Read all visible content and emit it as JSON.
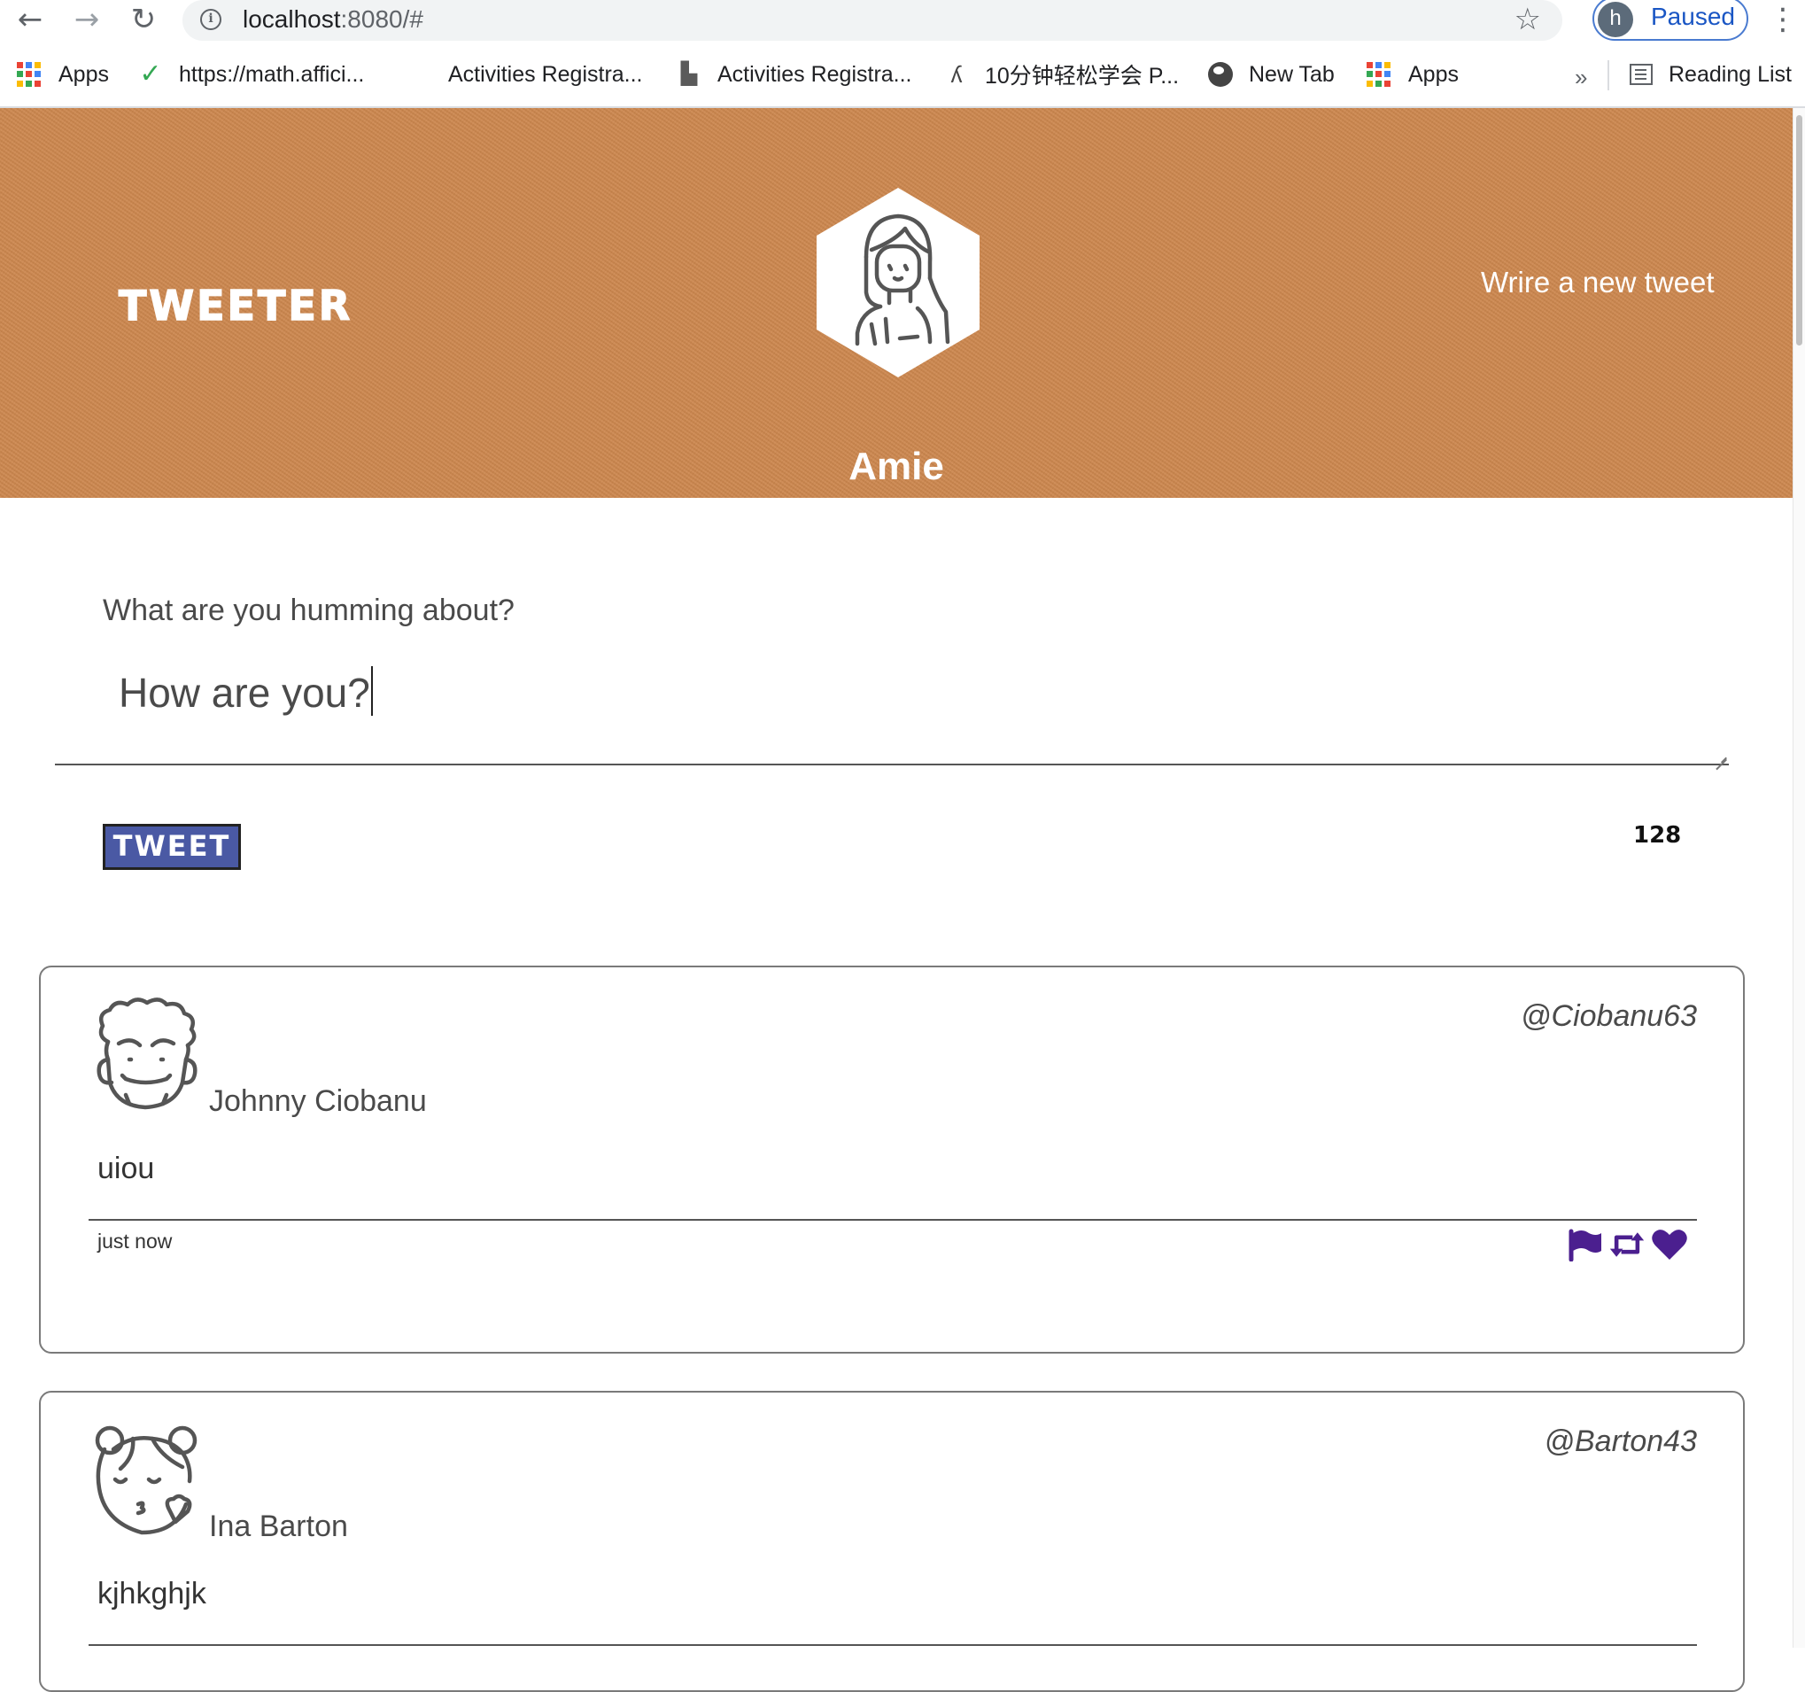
{
  "browser": {
    "url_host": "localhost",
    "url_rest": ":8080/#",
    "profile_initial": "h",
    "profile_status": "Paused",
    "bookmarks": [
      {
        "label": "Apps",
        "icon": "apps-grid-icon"
      },
      {
        "label": "https://math.affici...",
        "icon": "checkmark-icon"
      },
      {
        "label": "Activities Registra...",
        "icon": "none"
      },
      {
        "label": "Activities Registra...",
        "icon": "building-icon"
      },
      {
        "label": "10分钟轻松学会 P...",
        "icon": "glyph-icon"
      },
      {
        "label": "New Tab",
        "icon": "globe-icon"
      },
      {
        "label": "Apps",
        "icon": "apps-grid-icon"
      }
    ],
    "overflow": "»",
    "reading_list": "Reading List"
  },
  "header": {
    "logo": "TWEETER",
    "new_tweet_link": "Wrire a new tweet",
    "username": "Amie",
    "background": "#cd874e"
  },
  "composer": {
    "prompt": "What are you humming about?",
    "value": "How are you?",
    "button_label": "TWEET",
    "char_count": "128",
    "button_color": "#4a59a4"
  },
  "tweets": [
    {
      "author": "Johnny Ciobanu",
      "handle": "@Ciobanu63",
      "content": "uiou",
      "time": "just now",
      "avatar": "curly-hair-man-avatar-icon"
    },
    {
      "author": "Ina Barton",
      "handle": "@Barton43",
      "content": "kjhkghjk",
      "time": "",
      "avatar": "girl-kiss-avatar-icon"
    }
  ],
  "colors": {
    "action_icons": "#4b1f8f",
    "border": "#7a7a7a"
  }
}
